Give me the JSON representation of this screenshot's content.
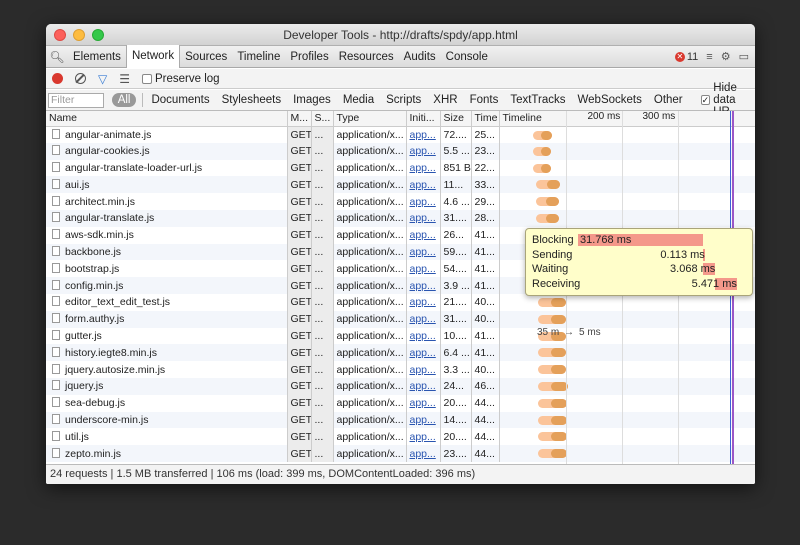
{
  "window": {
    "title": "Developer Tools - http://drafts/spdy/app.html"
  },
  "tabs": [
    "Elements",
    "Network",
    "Sources",
    "Timeline",
    "Profiles",
    "Resources",
    "Audits",
    "Console"
  ],
  "active_tab": "Network",
  "error_count": "11",
  "toolbar": {
    "preserve_log": "Preserve log",
    "hide_data_urls": "Hide data UR"
  },
  "filter": {
    "placeholder": "Filter",
    "all": "All",
    "types": [
      "Documents",
      "Stylesheets",
      "Images",
      "Media",
      "Scripts",
      "XHR",
      "Fonts",
      "TextTracks",
      "WebSockets",
      "Other"
    ]
  },
  "columns": {
    "name": "Name",
    "method": "M...",
    "status": "S...",
    "type": "Type",
    "initiator": "Initi...",
    "size": "Size",
    "time": "Time",
    "timeline": "Timeline",
    "tick1": "200 ms",
    "tick2": "300 ms"
  },
  "rows": [
    {
      "name": "angular-animate.js",
      "method": "GET",
      "status": "...",
      "type": "application/x...",
      "initiator": "app...",
      "size": "72....",
      "time": "25...",
      "bar": [
        0.52,
        0.16
      ]
    },
    {
      "name": "angular-cookies.js",
      "method": "GET",
      "status": "...",
      "type": "application/x...",
      "initiator": "app...",
      "size": "5.5 ...",
      "time": "23...",
      "bar": [
        0.52,
        0.15
      ]
    },
    {
      "name": "angular-translate-loader-url.js",
      "method": "GET",
      "status": "...",
      "type": "application/x...",
      "initiator": "app...",
      "size": "851 B",
      "time": "22...",
      "bar": [
        0.52,
        0.15
      ]
    },
    {
      "name": "aui.js",
      "method": "GET",
      "status": "...",
      "type": "application/x...",
      "initiator": "app...",
      "size": "11...",
      "time": "33...",
      "bar": [
        0.53,
        0.2
      ]
    },
    {
      "name": "architect.min.js",
      "method": "GET",
      "status": "...",
      "type": "application/x...",
      "initiator": "app...",
      "size": "4.6 ...",
      "time": "29...",
      "bar": [
        0.53,
        0.19
      ]
    },
    {
      "name": "angular-translate.js",
      "method": "GET",
      "status": "...",
      "type": "application/x...",
      "initiator": "app...",
      "size": "31....",
      "time": "28...",
      "bar": [
        0.53,
        0.19
      ]
    },
    {
      "name": "aws-sdk.min.js",
      "method": "GET",
      "status": "...",
      "type": "application/x...",
      "initiator": "app...",
      "size": "26...",
      "time": "41...",
      "bar": [
        0.54,
        0.23
      ]
    },
    {
      "name": "backbone.js",
      "method": "GET",
      "status": "...",
      "type": "application/x...",
      "initiator": "app...",
      "size": "59....",
      "time": "41...",
      "bar": [
        0.54,
        0.23
      ]
    },
    {
      "name": "bootstrap.js",
      "method": "GET",
      "status": "...",
      "type": "application/x...",
      "initiator": "app...",
      "size": "54....",
      "time": "41...",
      "bar": [
        0.54,
        0.23
      ]
    },
    {
      "name": "config.min.js",
      "method": "GET",
      "status": "...",
      "type": "application/x...",
      "initiator": "app...",
      "size": "3.9 ...",
      "time": "41...",
      "bar": [
        0.54,
        0.23
      ]
    },
    {
      "name": "editor_text_edit_test.js",
      "method": "GET",
      "status": "...",
      "type": "application/x...",
      "initiator": "app...",
      "size": "21....",
      "time": "40...",
      "bar": [
        0.54,
        0.23
      ]
    },
    {
      "name": "form.authy.js",
      "method": "GET",
      "status": "...",
      "type": "application/x...",
      "initiator": "app...",
      "size": "31....",
      "time": "40...",
      "bar": [
        0.54,
        0.23
      ]
    },
    {
      "name": "gutter.js",
      "method": "GET",
      "status": "...",
      "type": "application/x...",
      "initiator": "app...",
      "size": "10....",
      "time": "41...",
      "bar": [
        0.54,
        0.23
      ]
    },
    {
      "name": "history.iegte8.min.js",
      "method": "GET",
      "status": "...",
      "type": "application/x...",
      "initiator": "app...",
      "size": "6.4 ...",
      "time": "41...",
      "bar": [
        0.54,
        0.23
      ]
    },
    {
      "name": "jquery.autosize.min.js",
      "method": "GET",
      "status": "...",
      "type": "application/x...",
      "initiator": "app...",
      "size": "3.3 ...",
      "time": "40...",
      "bar": [
        0.54,
        0.23
      ]
    },
    {
      "name": "jquery.js",
      "method": "GET",
      "status": "...",
      "type": "application/x...",
      "initiator": "app...",
      "size": "24...",
      "time": "46...",
      "bar": [
        0.54,
        0.25
      ]
    },
    {
      "name": "sea-debug.js",
      "method": "GET",
      "status": "...",
      "type": "application/x...",
      "initiator": "app...",
      "size": "20....",
      "time": "44...",
      "bar": [
        0.54,
        0.24
      ]
    },
    {
      "name": "underscore-min.js",
      "method": "GET",
      "status": "...",
      "type": "application/x...",
      "initiator": "app...",
      "size": "14....",
      "time": "44...",
      "bar": [
        0.54,
        0.24
      ]
    },
    {
      "name": "util.js",
      "method": "GET",
      "status": "...",
      "type": "application/x...",
      "initiator": "app...",
      "size": "20....",
      "time": "44...",
      "bar": [
        0.54,
        0.24
      ]
    },
    {
      "name": "zepto.min.js",
      "method": "GET",
      "status": "...",
      "type": "application/x...",
      "initiator": "app...",
      "size": "23....",
      "time": "44...",
      "bar": [
        0.54,
        0.24
      ]
    }
  ],
  "tooltip": {
    "blocking_label": "Blocking",
    "blocking": "31.768 ms",
    "sending_label": "Sending",
    "sending": "0.113 ms",
    "waiting_label": "Waiting",
    "waiting": "3.068 ms",
    "receiving_label": "Receiving",
    "receiving": "5.471 ms",
    "bar_fractions": [
      0.78,
      0.003,
      0.075,
      0.135
    ]
  },
  "timing_labels": {
    "left": "35 m",
    "right": "5 ms"
  },
  "status": "24 requests | 1.5 MB transferred | 106 ms (load: 399 ms, DOMContentLoaded: 396 ms)",
  "colors": {
    "blocking": "#f4988a",
    "bar_light": "#fbc49a",
    "bar_dark": "#e4a05a",
    "load_line": "#9b57c7",
    "dom_line": "#3b63d6"
  }
}
